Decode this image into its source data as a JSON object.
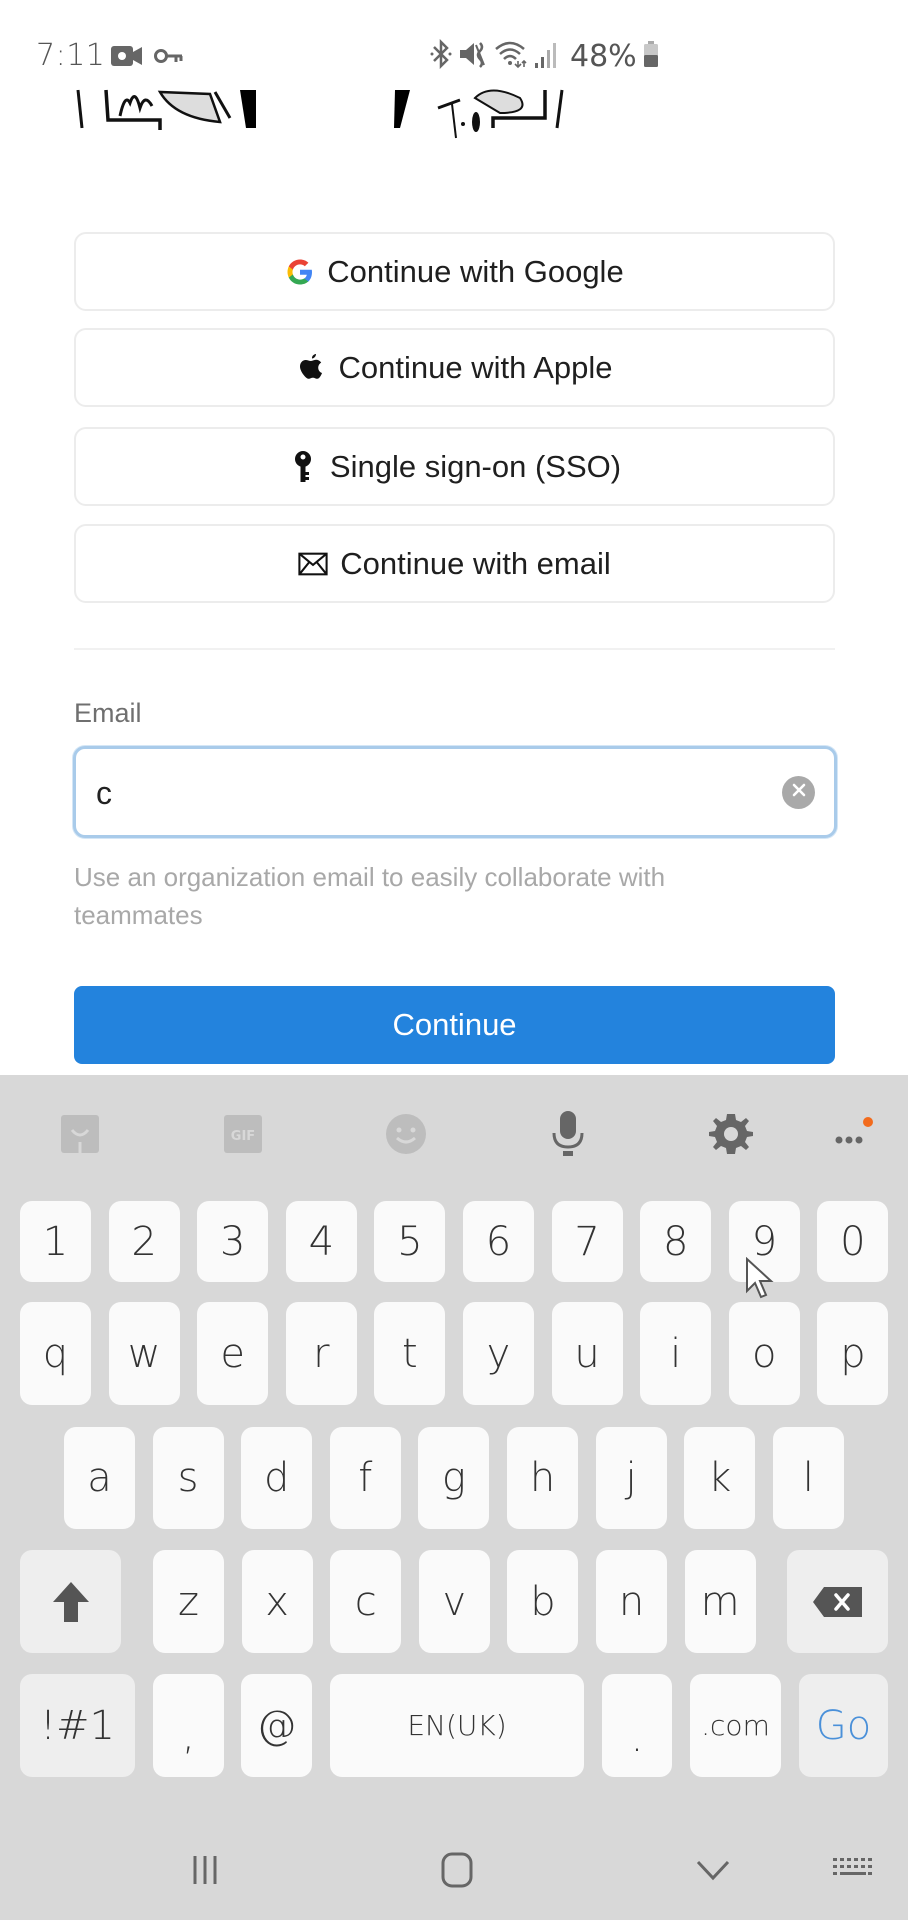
{
  "status_bar": {
    "time": "7:11",
    "left_icons": [
      "video-record-icon",
      "vpn-key-icon"
    ],
    "right_icons": [
      "bluetooth-icon",
      "mute-vibrate-icon",
      "wifi-icon",
      "cellular-signal-icon",
      "battery-icon"
    ],
    "battery_percent": "48%"
  },
  "auth_options": [
    {
      "label": "Continue with Google",
      "icon": "google-icon"
    },
    {
      "label": "Continue with Apple",
      "icon": "apple-icon"
    },
    {
      "label": "Single sign-on (SSO)",
      "icon": "key-icon"
    },
    {
      "label": "Continue with email",
      "icon": "mail-icon"
    }
  ],
  "email_form": {
    "label": "Email",
    "value": "c",
    "placeholder": "",
    "helper_text": "Use an organization email to easily collaborate with teammates",
    "submit_label": "Continue"
  },
  "colors": {
    "primary": "#2383dd",
    "input_focus_border": "#a9cbea",
    "keyboard_bg": "#d8d8d8",
    "go_key": "#4a90d9",
    "notification_dot": "#f26b1d"
  },
  "keyboard": {
    "toolbar": [
      "sticker-icon",
      "gif-icon",
      "emoji-icon",
      "microphone-icon",
      "settings-icon",
      "more-icon"
    ],
    "rows": [
      [
        "1",
        "2",
        "3",
        "4",
        "5",
        "6",
        "7",
        "8",
        "9",
        "0"
      ],
      [
        "q",
        "w",
        "e",
        "r",
        "t",
        "y",
        "u",
        "i",
        "o",
        "p"
      ],
      [
        "a",
        "s",
        "d",
        "f",
        "g",
        "h",
        "j",
        "k",
        "l"
      ],
      [
        "z",
        "x",
        "c",
        "v",
        "b",
        "n",
        "m"
      ]
    ],
    "bottom": {
      "symbols": "!#1",
      "comma": ",",
      "at": "@",
      "space": "EN(UK)",
      "period": ".",
      "dotcom": ".com",
      "go": "Go"
    }
  },
  "navigation_bar": [
    "recent-apps-icon",
    "home-icon",
    "back-icon",
    "keyboard-switch-icon"
  ]
}
